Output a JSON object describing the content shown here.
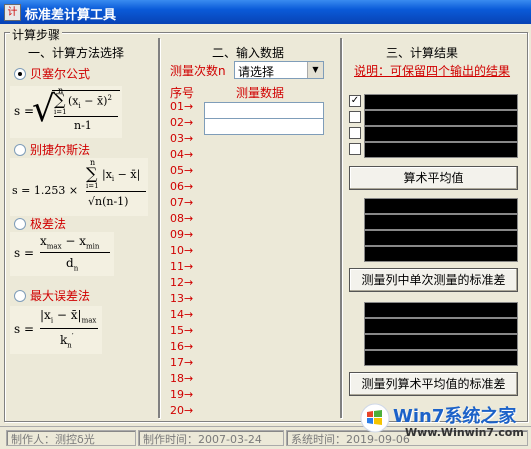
{
  "window": {
    "title": "标准差计算工具",
    "app_icon": "计"
  },
  "left": {
    "frame_label": "计算步骤",
    "section_title": "一、计算方法选择",
    "methods": [
      {
        "label": "贝塞尔公式",
        "selected": true
      },
      {
        "label": "别捷尔斯法",
        "selected": false
      },
      {
        "label": "极差法",
        "selected": false
      },
      {
        "label": "最大误差法",
        "selected": false
      }
    ],
    "formulas": {
      "bessel": {
        "lhs": "s =",
        "sum_top": "n",
        "sum_bottom": "i=1",
        "term": "(x",
        "sub": "i",
        "tail": " − x̄)",
        "sup": "2",
        "denominator": "n-1"
      },
      "peters": {
        "lhs": "s = 1.253 ×",
        "sum_top": "n",
        "sum_bottom": "i=1",
        "term": "|x",
        "sub": "i",
        "tail": " − x̄|",
        "denominator": "√n(n-1)"
      },
      "range": {
        "lhs": "s =",
        "num_a": "x",
        "num_a_sub": "max",
        "minus": " − ",
        "num_b": "x",
        "num_b_sub": "min",
        "den": "d",
        "den_sub": "n"
      },
      "maxerr": {
        "lhs": "s =",
        "num": "|x",
        "num_sub": "i",
        "num_tail": " − x̄|",
        "num_post": "max",
        "den": "k",
        "den_sub": "n",
        "den_prime": "′"
      }
    }
  },
  "middle": {
    "section_title": "二、输入数据",
    "count_label": "测量次数n",
    "count_select": "请选择",
    "col_index": "序号",
    "col_data": "测量数据",
    "rows": [
      "01→",
      "02→",
      "03→",
      "04→",
      "05→",
      "06→",
      "07→",
      "08→",
      "09→",
      "10→",
      "11→",
      "12→",
      "13→",
      "14→",
      "15→",
      "16→",
      "17→",
      "18→",
      "19→",
      "20→"
    ]
  },
  "right": {
    "section_title": "三、计算结果",
    "note": "说明：可保留四个输出的结果",
    "checkboxes": [
      true,
      false,
      false,
      false
    ],
    "btn_mean": "算术平均值",
    "btn_single_std": "测量列中单次测量的标准差",
    "btn_mean_std": "测量列算术平均值的标准差"
  },
  "status": {
    "author": "制作人：测控δ光",
    "date": "制作时间：2007-03-24",
    "systime": "系统时间：2019-09-06"
  },
  "watermark": {
    "brand": "Win7系统之家",
    "url": "Www.Winwin7.com"
  }
}
